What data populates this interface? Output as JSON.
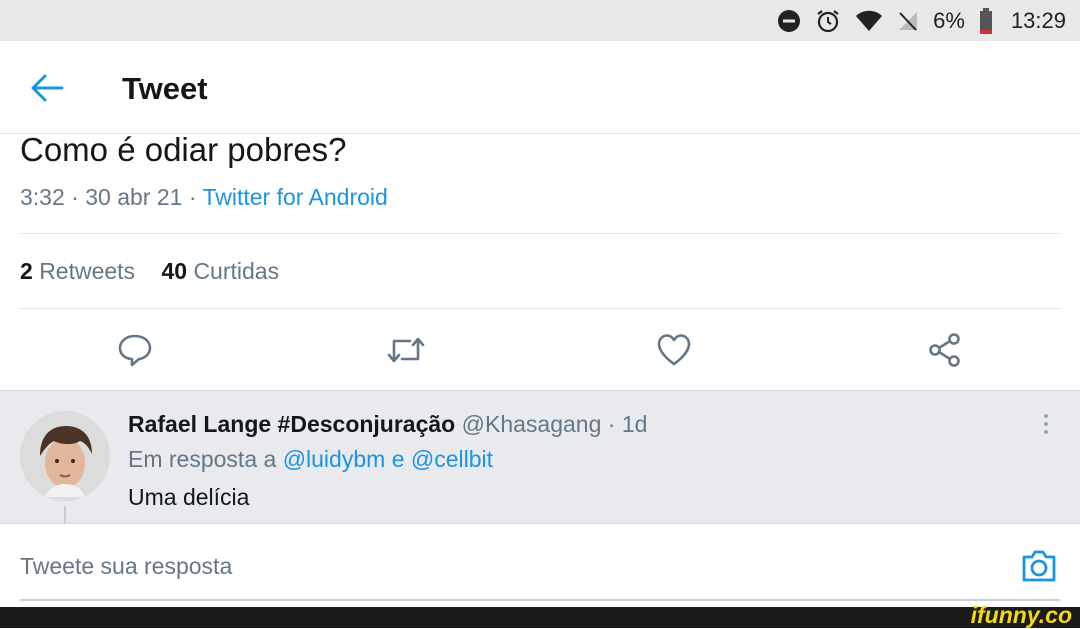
{
  "status_bar": {
    "battery": "6%",
    "time": "13:29"
  },
  "header": {
    "title": "Tweet"
  },
  "tweet": {
    "text": "Como é odiar pobres?",
    "time": "3:32",
    "date": "30 abr 21",
    "source": "Twitter for Android",
    "retweet_count": "2",
    "retweet_label": "Retweets",
    "like_count": "40",
    "like_label": "Curtidas"
  },
  "reply": {
    "name": "Rafael Lange #Desconjuração",
    "handle": "@Khasagang",
    "age": "1d",
    "reply_prefix": "Em resposta a",
    "mention1": "@luidybm",
    "conj": "e",
    "mention2": "@cellbit",
    "text": "Uma delícia"
  },
  "composer": {
    "placeholder": "Tweete sua resposta"
  },
  "watermark": "ifunny.co",
  "colors": {
    "accent": "#1b95e0",
    "muted": "#657786",
    "reply_bg": "#e8eaed"
  }
}
